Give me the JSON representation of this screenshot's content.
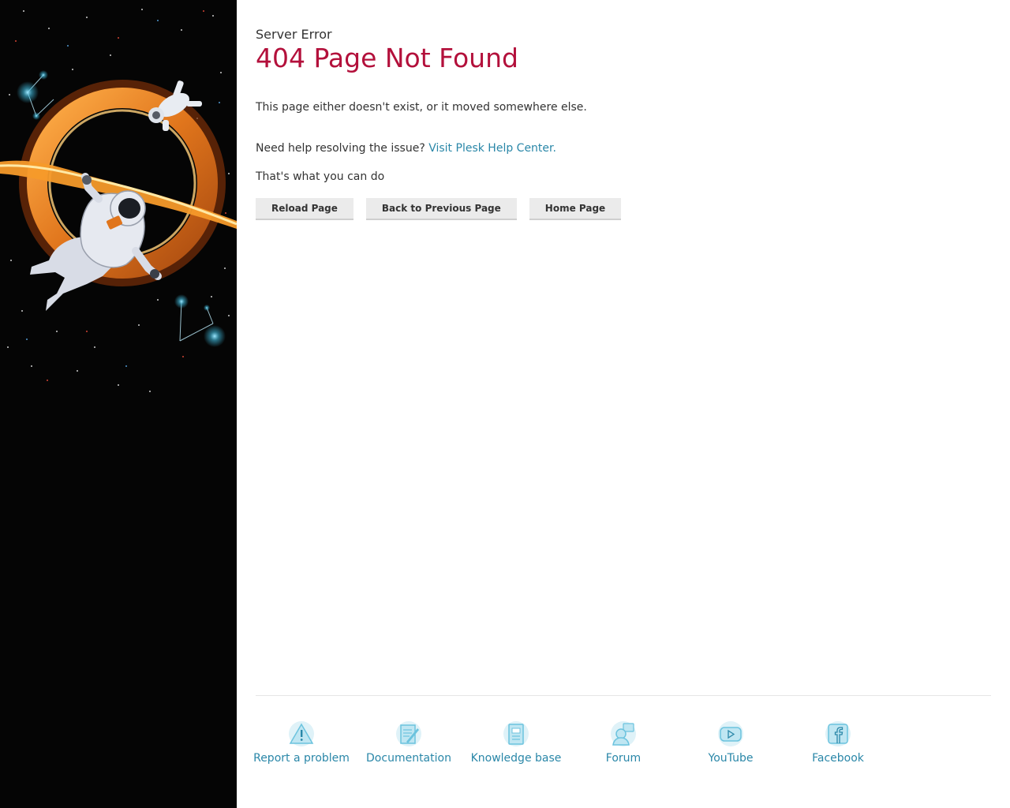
{
  "header": {
    "subtitle": "Server Error",
    "title": "404 Page Not Found"
  },
  "body": {
    "description": "This page either doesn't exist, or it moved somewhere else.",
    "help_text": "Need help resolving the issue?",
    "help_link": "Visit Plesk Help Center.",
    "actions_heading": "That's what you can do"
  },
  "actions": {
    "reload": "Reload Page",
    "back": "Back to Previous Page",
    "home": "Home Page"
  },
  "footer": {
    "links": [
      {
        "label": "Report a problem",
        "icon": "warning-icon"
      },
      {
        "label": "Documentation",
        "icon": "document-icon"
      },
      {
        "label": "Knowledge base",
        "icon": "book-icon"
      },
      {
        "label": "Forum",
        "icon": "forum-icon"
      },
      {
        "label": "YouTube",
        "icon": "youtube-icon"
      },
      {
        "label": "Facebook",
        "icon": "facebook-icon"
      }
    ]
  },
  "colors": {
    "title": "#b3103b",
    "link": "#2a87a8",
    "sidebar_bg": "#050505"
  }
}
